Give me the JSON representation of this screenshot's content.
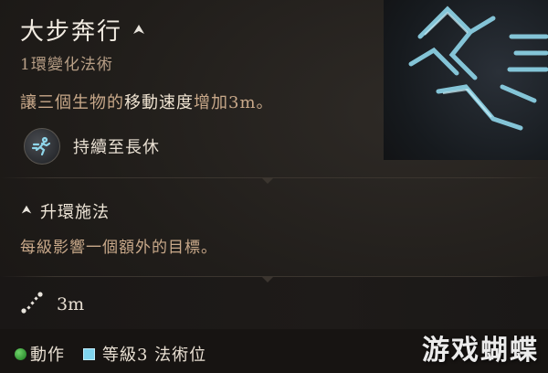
{
  "spell": {
    "name": "大步奔行",
    "school_level": "1環變化法術",
    "description_prefix": "讓三個生物的",
    "description_highlight": "移動速度",
    "description_suffix": "增加3m。",
    "duration": "持續至長休",
    "upcast": {
      "title": "升環施法",
      "description": "每級影響一個額外的目標。"
    },
    "range": "3m",
    "cost": {
      "action_label": "動作",
      "slot_label": "等級3 法術位",
      "action_color": "#3fae3c",
      "slot_color": "#7fd4ee"
    }
  },
  "watermark": "游戏蝴蝶",
  "icons": {
    "upcast": "upcast-chevron-icon",
    "duration": "running-figure-icon",
    "range": "range-ruler-icon",
    "spell_art": "longstrider-spell-art"
  },
  "colors": {
    "title": "#f2ece2",
    "subtitle": "#b89f86",
    "text": "#c9a98a",
    "highlight": "#efe3d1",
    "art_glow": "#8fd6ea"
  }
}
